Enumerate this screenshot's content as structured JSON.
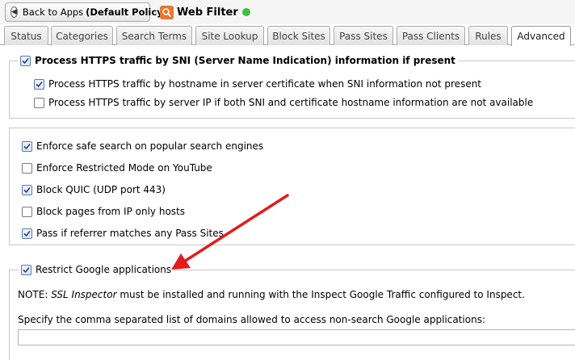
{
  "header": {
    "back_button_prefix": "Back to Apps",
    "back_button_policy": "(Default Policy)",
    "app_title": "Web Filter",
    "status_color": "#3fbf3f"
  },
  "tabs": [
    {
      "label": "Status"
    },
    {
      "label": "Categories"
    },
    {
      "label": "Search Terms"
    },
    {
      "label": "Site Lookup"
    },
    {
      "label": "Block Sites"
    },
    {
      "label": "Pass Sites"
    },
    {
      "label": "Pass Clients"
    },
    {
      "label": "Rules"
    },
    {
      "label": "Advanced",
      "active": true
    }
  ],
  "sni": {
    "legend": "Process HTTPS traffic by SNI (Server Name Indication) information if present",
    "legend_checked": true,
    "options": [
      {
        "label": "Process HTTPS traffic by hostname in server certificate when SNI information not present",
        "checked": true
      },
      {
        "label": "Process HTTPS traffic by server IP if both SNI and certificate hostname information are not available",
        "checked": false
      }
    ]
  },
  "general": {
    "options": [
      {
        "label": "Enforce safe search on popular search engines",
        "checked": true
      },
      {
        "label": "Enforce Restricted Mode on YouTube",
        "checked": false
      },
      {
        "label": "Block QUIC (UDP port 443)",
        "checked": true
      },
      {
        "label": "Block pages from IP only hosts",
        "checked": false
      },
      {
        "label": "Pass if referrer matches any Pass Sites",
        "checked": true
      }
    ]
  },
  "google": {
    "legend": "Restrict Google applications",
    "legend_checked": true,
    "note_prefix": "NOTE:",
    "note_italic": "SSL Inspector",
    "note_suffix": "must be installed and running with the Inspect Google Traffic configured to Inspect.",
    "domains_label": "Specify the comma separated list of domains allowed to access non-search Google applications:",
    "domains_value": ""
  },
  "annotation_color": "#e31b1b"
}
